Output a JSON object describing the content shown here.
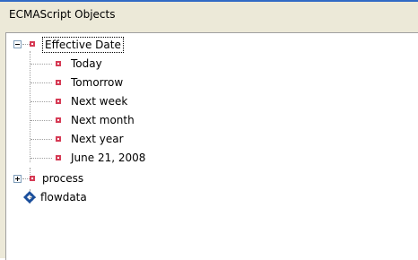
{
  "window": {
    "title": "ECMAScript Objects"
  },
  "tree": {
    "root": {
      "label": "Effective Date"
    },
    "children": [
      {
        "label": "Today"
      },
      {
        "label": "Tomorrow"
      },
      {
        "label": "Next week"
      },
      {
        "label": "Next month"
      },
      {
        "label": "Next year"
      },
      {
        "label": "June 21, 2008"
      }
    ],
    "process": {
      "label": "process"
    },
    "flowdata": {
      "label": "flowdata"
    }
  },
  "colors": {
    "accent": "#316ac5",
    "bullet": "#d63b55",
    "flowdata_icon": "#1a4f9c"
  }
}
